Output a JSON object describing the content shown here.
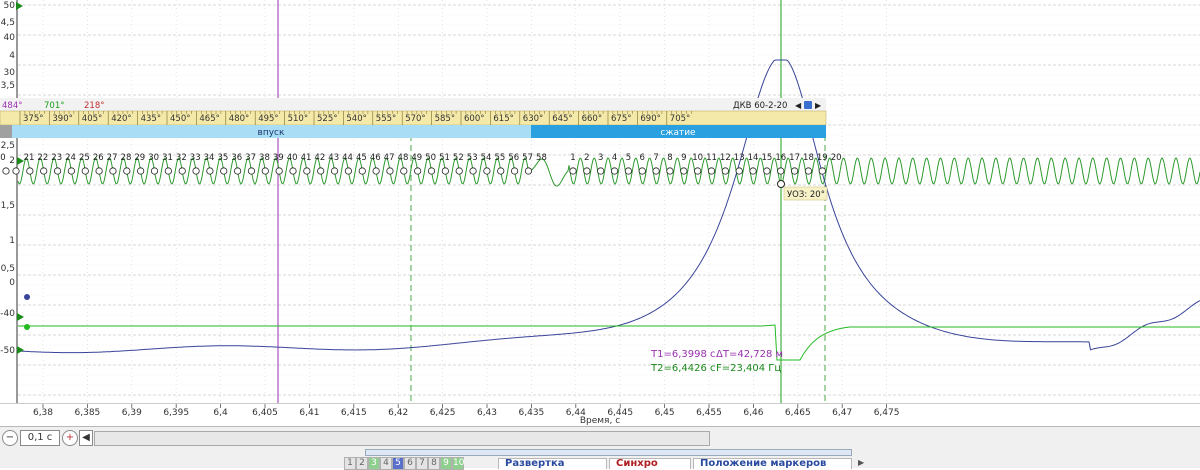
{
  "y_left_top_labels": [
    "50",
    "4,5",
    "40",
    "4",
    "30",
    "3,5"
  ],
  "y_left_lower_labels": [
    "2,5",
    "2",
    "1,5",
    "1",
    "0,5",
    "0",
    "-40",
    "-50"
  ],
  "marker_bar": {
    "m1": "484°",
    "m2": "701°",
    "delta": "218°",
    "sensor": "ДКВ 60-2-20",
    "lock_icon": "lock-icon"
  },
  "degree_scale": [
    "375°",
    "390°",
    "405°",
    "420°",
    "435°",
    "450°",
    "465°",
    "480°",
    "495°",
    "510°",
    "525°",
    "540°",
    "555°",
    "570°",
    "585°",
    "600°",
    "615°",
    "630°",
    "645°",
    "660°",
    "675°",
    "690°",
    "705°"
  ],
  "phases": {
    "intake": "впуск",
    "compression": "сжатие"
  },
  "tooth_numbers": [
    "0",
    "21",
    "22",
    "23",
    "24",
    "25",
    "26",
    "27",
    "28",
    "29",
    "30",
    "31",
    "32",
    "33",
    "34",
    "35",
    "36",
    "37",
    "38",
    "39",
    "40",
    "41",
    "42",
    "43",
    "44",
    "45",
    "46",
    "47",
    "48",
    "49",
    "50",
    "51",
    "52",
    "53",
    "54",
    "55",
    "56",
    "57",
    "58",
    "1",
    "2",
    "3",
    "4",
    "5",
    "6",
    "7",
    "8",
    "9",
    "10",
    "11",
    "12",
    "13",
    "14",
    "15",
    "16",
    "17",
    "18",
    "19",
    "20"
  ],
  "uoz_label": "УОЗ: 20°",
  "measurements": {
    "t1": "T1=6,3998 с",
    "dt": "ΔT=42,728 м",
    "t2": "T2=6,4426 с",
    "f": "F=23,404 Гц"
  },
  "x_axis": {
    "ticks": [
      "6,38",
      "6,385",
      "6,39",
      "6,395",
      "6,4",
      "6,405",
      "6,41",
      "6,415",
      "6,42",
      "6,425",
      "6,43",
      "6,435",
      "6,44",
      "6,445",
      "6,45",
      "6,455",
      "6,46",
      "6,465",
      "6,47",
      "6,475"
    ],
    "label": "Время, с"
  },
  "toolbar": {
    "timebase": "0,1 с",
    "tab_numbers": [
      "1",
      "2",
      "3",
      "4",
      "5",
      "6",
      "7",
      "8",
      "9",
      "10"
    ],
    "sections": [
      "Развертка",
      "Синхро",
      "Положение маркеров"
    ]
  },
  "colors": {
    "pressure": "#3a4499",
    "crank": "#2e9a2e",
    "ignition": "#22bb22",
    "marker1": "#9b30b0",
    "marker2": "#1aa01a",
    "phase_intake": "#a9dcf5",
    "phase_compression": "#2aa0e0",
    "ruler": "#f4e9a8"
  }
}
